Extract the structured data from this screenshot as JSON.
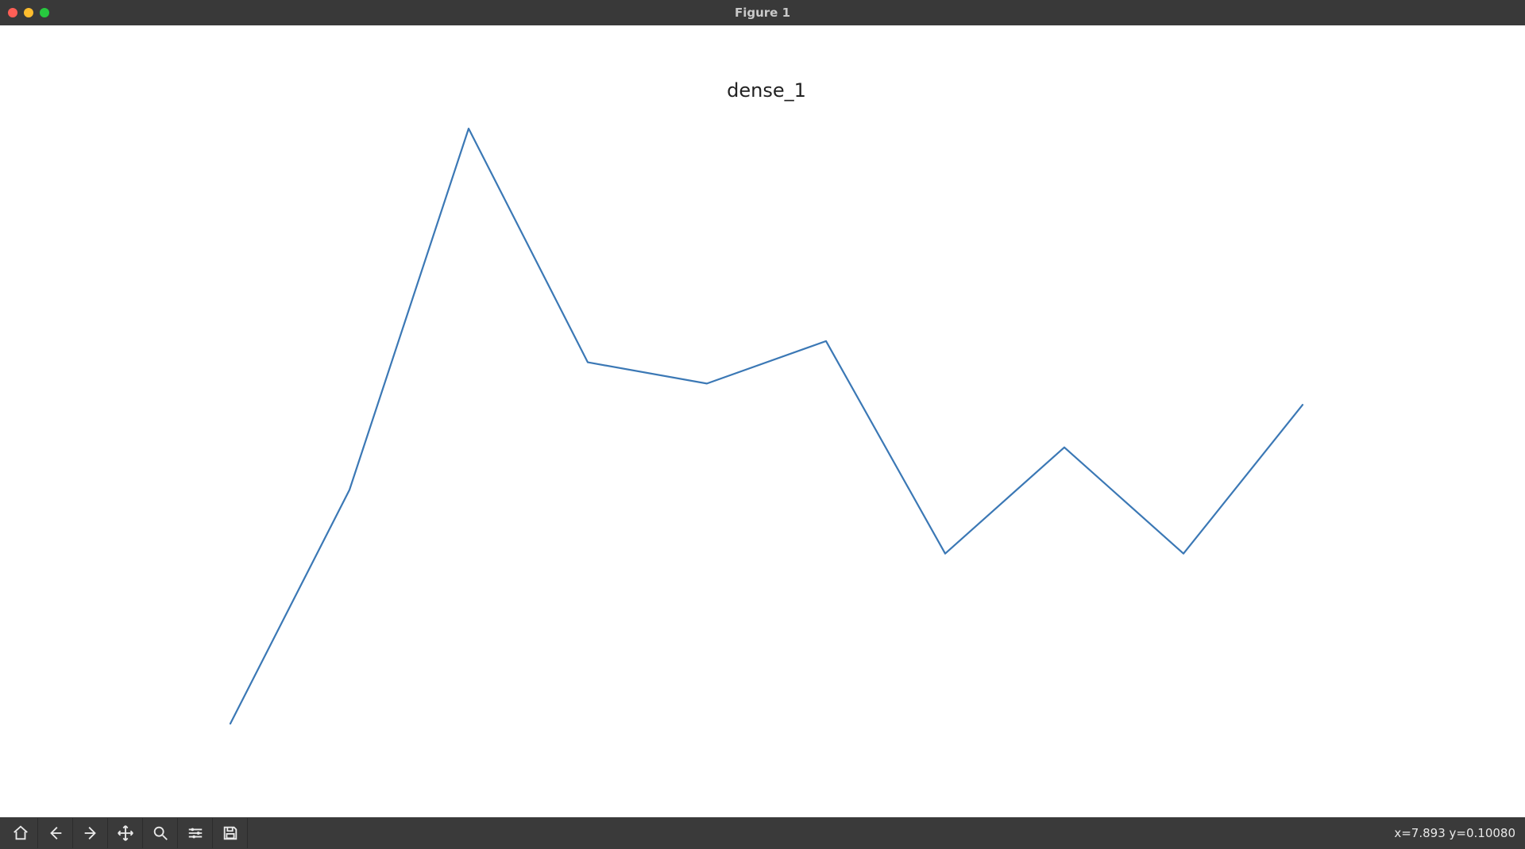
{
  "window": {
    "title": "Figure 1"
  },
  "chart_data": {
    "type": "line",
    "title": "dense_1",
    "xlabel": "",
    "ylabel": "",
    "series": [
      {
        "name": "dense_1",
        "x": [
          0,
          1,
          2,
          3,
          4,
          5,
          6,
          7,
          8,
          9
        ],
        "values": [
          0.092,
          0.103,
          0.12,
          0.109,
          0.108,
          0.11,
          0.1,
          0.105,
          0.1,
          0.107
        ]
      }
    ],
    "xlim": [
      0,
      9
    ],
    "ylim": [
      0.092,
      0.12
    ],
    "axis_visible": false
  },
  "toolbar": {
    "home_tip": "Home",
    "back_tip": "Back",
    "forward_tip": "Forward",
    "pan_tip": "Pan",
    "zoom_tip": "Zoom",
    "subplots_tip": "Configure subplots",
    "save_tip": "Save"
  },
  "status": {
    "coord_text": "x=7.893 y=0.10080"
  }
}
